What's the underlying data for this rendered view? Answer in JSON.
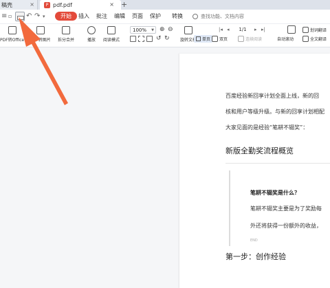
{
  "tabs": {
    "prev_label": "稿壳",
    "current_label": "pdf.pdf",
    "pdf_icon": "pdf-icon",
    "close_icon": "close-icon",
    "add_icon": "plus-icon"
  },
  "menu": {
    "items": [
      "开始",
      "插入",
      "批注",
      "编辑",
      "页面",
      "保护",
      "转换"
    ],
    "active_item": "开始",
    "search_placeholder": "查找功能、文档内容"
  },
  "toolbar": {
    "pdf_to_office": "PDF转Office",
    "pdf_to_image": "PDF转图片",
    "split_merge": "拆分合并",
    "play": "播放",
    "read_mode": "阅读模式",
    "zoom_value": "100%",
    "zoom_in": "+",
    "zoom_out": "−",
    "rotate_doc": "旋转文档",
    "page_indicator": "1/1",
    "auto_scroll": "自动滚动",
    "translate": "划词翻译",
    "full_translate": "全文翻译",
    "single_page": "单页",
    "double_page": "双页",
    "continuous": "连续阅读"
  },
  "document": {
    "para_line_1": "百度经验新回享计划全面上线，新的回",
    "para_line_2": "核和用户等级升级。与新的回享计划相配",
    "para_line_3": "大家见面的是经验“笔耕不辍奖”：",
    "heading_new": "新版全勤奖流程概览",
    "quote_title": "笔耕不辍奖是什么？",
    "quote_line_1": "笔耕不辍奖主要是为了奖励每",
    "quote_line_2": "外还将获得一份额外的收益，",
    "quote_end": "END",
    "heading_step": "第一步：创作经验"
  },
  "colors": {
    "accent": "#e34a3a",
    "annotation_arrow": "#f26a3d"
  }
}
